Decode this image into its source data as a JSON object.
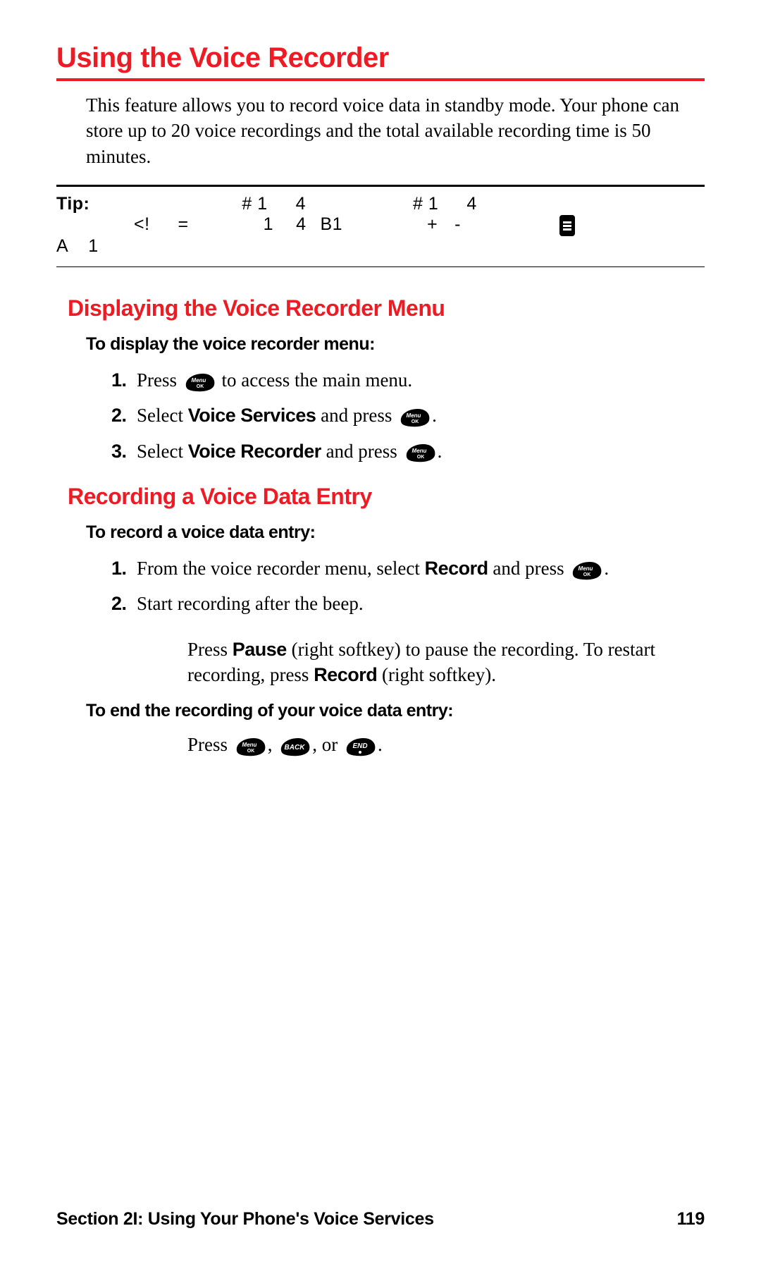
{
  "title": "Using the Voice Recorder",
  "intro": "This feature allows you to record voice data in standby mode. Your phone can store up to 20 voice recordings and the total available recording time is 50 minutes.",
  "tip": {
    "label": "Tip:",
    "row1_seg1": "# 1",
    "row1_seg2": "4",
    "row1_seg3": "# 1",
    "row1_seg4": "4",
    "row2_seg1": "<!",
    "row2_seg2": "=",
    "row2_seg3": "1",
    "row2_seg4": "4",
    "row2_seg5": "B1",
    "row2_seg6": "+",
    "row2_seg7": "-",
    "row3_seg1": "A",
    "row3_seg2": "1"
  },
  "section1": {
    "heading": "Displaying the Voice Recorder Menu",
    "instr": "To display the voice recorder menu:",
    "steps": {
      "s1_pre": "Press ",
      "s1_post": " to access the main menu.",
      "s2_pre": "Select ",
      "s2_bold": "Voice Services",
      "s2_post": " and press ",
      "s3_pre": "Select ",
      "s3_bold": "Voice Recorder",
      "s3_post": " and press "
    }
  },
  "section2": {
    "heading": "Recording a Voice Data Entry",
    "instr1": "To record a voice data entry:",
    "steps": {
      "s1_pre": "From the voice recorder menu, select ",
      "s1_bold": "Record",
      "s1_post": " and press ",
      "s2": "Start recording after the beep."
    },
    "note_pre": "Press ",
    "note_b1": "Pause",
    "note_mid": " (right softkey) to pause the recording. To restart recording, press ",
    "note_b2": "Record",
    "note_post": " (right softkey).",
    "instr2": "To end the recording of your voice data entry:",
    "press_pre": "Press ",
    "comma1": ", ",
    "comma2": ", or ",
    "period": "."
  },
  "nums": {
    "n1": "1.",
    "n2": "2.",
    "n3": "3."
  },
  "icons": {
    "menu": "menu-ok-key-icon",
    "back": "back-key-icon",
    "end": "end-key-icon",
    "list": "list-icon"
  },
  "footer": {
    "section": "Section 2I: Using Your Phone's Voice Services",
    "page": "119"
  }
}
